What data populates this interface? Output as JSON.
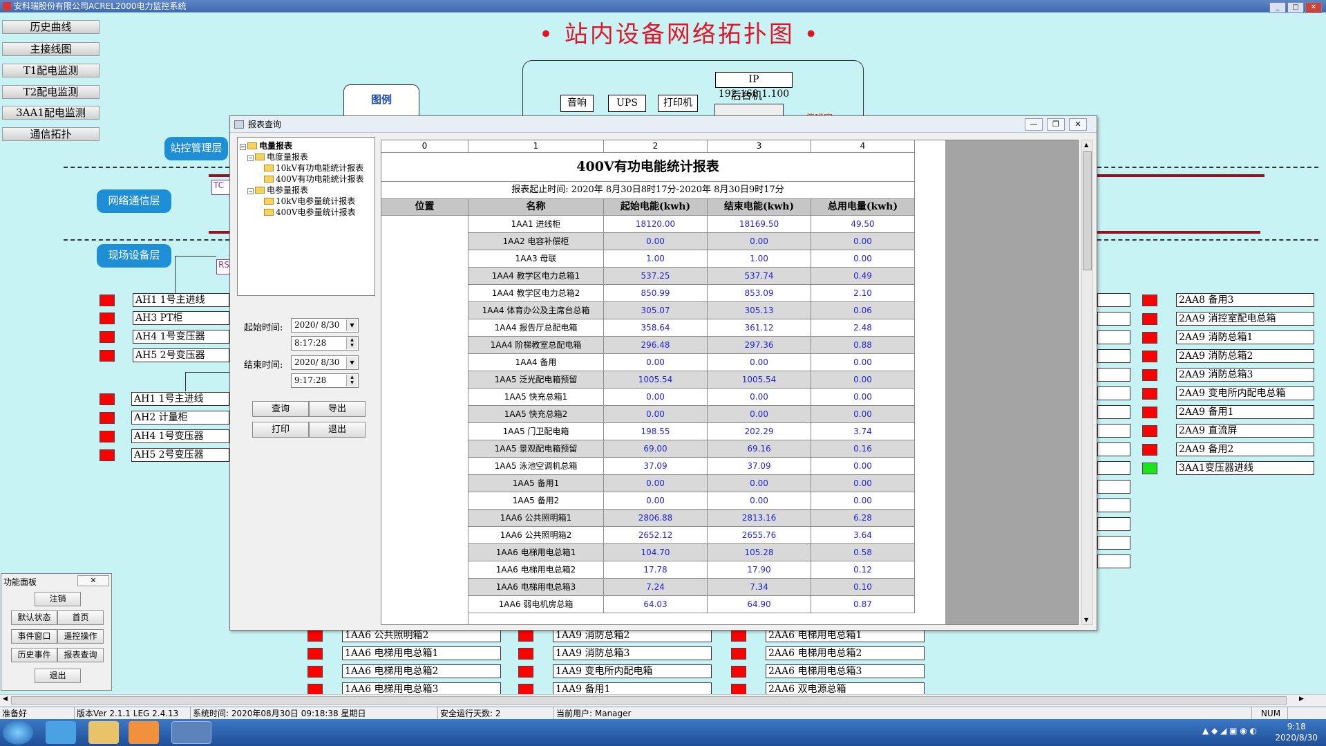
{
  "app": {
    "title": "安科瑞股份有限公司ACREL2000电力监控系统"
  },
  "nav": [
    "历史曲线",
    "主接线图",
    "T1配电监测",
    "T2配电监测",
    "3AA1配电监测",
    "通信拓扑"
  ],
  "main_title": "• 站内设备网络拓扑图 •",
  "layers": {
    "station": "站控管理层",
    "network": "网络通信层",
    "field": "现场设备层"
  },
  "topo": {
    "legend": "图例",
    "ip": "IP 192.168.1.100",
    "backend": "后台机",
    "speaker": "音响",
    "ups": "UPS",
    "printer": "打印机",
    "tcp_cut": "TC",
    "rs_cut": "RS",
    "comm_room_cut": "值班室"
  },
  "left_devices_1": [
    "AH1 1号主进线",
    "AH3 PT柜",
    "AH4 1号变压器",
    "AH5 2号变压器"
  ],
  "left_devices_2": [
    "AH1 1号主进线",
    "AH2 计量柜",
    "AH4 1号变压器",
    "AH5 2号变压器"
  ],
  "right_devices": [
    "2AA8 备用3",
    "2AA9 消控室配电总箱",
    "2AA9 消防总箱1",
    "2AA9 消防总箱2",
    "2AA9 消防总箱3",
    "2AA9 变电所内配电总箱",
    "2AA9 备用1",
    "2AA9 直流屏",
    "2AA9 备用2",
    "3AA1变压器进线"
  ],
  "right_device_colors": [
    "red",
    "red",
    "red",
    "red",
    "red",
    "red",
    "red",
    "red",
    "red",
    "green"
  ],
  "bottom_devices": [
    [
      "1AA6 公共照明箱2",
      "1AA6 电梯用电总箱1",
      "1AA6 电梯用电总箱2",
      "1AA6 电梯用电总箱3"
    ],
    [
      "1AA9 消防总箱2",
      "1AA9 消防总箱3",
      "1AA9 变电所内配电箱",
      "1AA9 备用1"
    ],
    [
      "2AA6 电梯用电总箱1",
      "2AA6 电梯用电总箱2",
      "2AA6 电梯用电总箱3",
      "2AA6 双电源总箱"
    ]
  ],
  "dialog": {
    "title": "报表查询",
    "tree": {
      "root": "电量报表",
      "group1": "电度量报表",
      "g1_items": [
        "10kV有功电能统计报表",
        "400V有功电能统计报表"
      ],
      "group2": "电参量报表",
      "g2_items": [
        "10kV电参量统计报表",
        "400V电参量统计报表"
      ]
    },
    "start_label": "起始时间:",
    "end_label": "结束时间:",
    "start_date": "2020/ 8/30",
    "start_time": "8:17:28",
    "end_date": "2020/ 8/30",
    "end_time": "9:17:28",
    "buttons": {
      "query": "查询",
      "export": "导出",
      "print": "打印",
      "exit": "退出"
    }
  },
  "report": {
    "col_index": [
      "0",
      "1",
      "2",
      "3",
      "4"
    ],
    "title": "400V有功电能统计报表",
    "period": "报表起止时间: 2020年 8月30日8时17分-2020年 8月30日9时17分",
    "headers": [
      "位置",
      "名称",
      "起始电能(kwh)",
      "结束电能(kwh)",
      "总用电量(kwh)"
    ],
    "rows": [
      [
        "1AA1 进线柜",
        "18120.00",
        "18169.50",
        "49.50"
      ],
      [
        "1AA2 电容补偿柜",
        "0.00",
        "0.00",
        "0.00"
      ],
      [
        "1AA3 母联",
        "1.00",
        "1.00",
        "0.00"
      ],
      [
        "1AA4 教学区电力总箱1",
        "537.25",
        "537.74",
        "0.49"
      ],
      [
        "1AA4 教学区电力总箱2",
        "850.99",
        "853.09",
        "2.10"
      ],
      [
        "1AA4 体育办公及主席台总箱",
        "305.07",
        "305.13",
        "0.06"
      ],
      [
        "1AA4 报告厅总配电箱",
        "358.64",
        "361.12",
        "2.48"
      ],
      [
        "1AA4 阶梯教室总配电箱",
        "296.48",
        "297.36",
        "0.88"
      ],
      [
        "1AA4 备用",
        "0.00",
        "0.00",
        "0.00"
      ],
      [
        "1AA5 泛光配电箱预留",
        "1005.54",
        "1005.54",
        "0.00"
      ],
      [
        "1AA5 快充总箱1",
        "0.00",
        "0.00",
        "0.00"
      ],
      [
        "1AA5 快充总箱2",
        "0.00",
        "0.00",
        "0.00"
      ],
      [
        "1AA5 门卫配电箱",
        "198.55",
        "202.29",
        "3.74"
      ],
      [
        "1AA5 景观配电箱预留",
        "69.00",
        "69.16",
        "0.16"
      ],
      [
        "1AA5 泳池空调机总箱",
        "37.09",
        "37.09",
        "0.00"
      ],
      [
        "1AA5 备用1",
        "0.00",
        "0.00",
        "0.00"
      ],
      [
        "1AA5 备用2",
        "0.00",
        "0.00",
        "0.00"
      ],
      [
        "1AA6 公共照明箱1",
        "2806.88",
        "2813.16",
        "6.28"
      ],
      [
        "1AA6 公共照明箱2",
        "2652.12",
        "2655.76",
        "3.64"
      ],
      [
        "1AA6 电梯用电总箱1",
        "104.70",
        "105.28",
        "0.58"
      ],
      [
        "1AA6 电梯用电总箱2",
        "17.78",
        "17.90",
        "0.12"
      ],
      [
        "1AA6 电梯用电总箱3",
        "7.24",
        "7.34",
        "0.10"
      ],
      [
        "1AA6 弱电机房总箱",
        "64.03",
        "64.90",
        "0.87"
      ]
    ]
  },
  "function_panel": {
    "title": "功能面板",
    "buttons": [
      "注销",
      "默认状态",
      "首页",
      "事件窗口",
      "遥控操作",
      "历史事件",
      "报表查询",
      "退出"
    ]
  },
  "status": {
    "ready": "准备好",
    "version": "版本Ver 2.1.1 LEG 2.4.13",
    "system_time": "系统时间: 2020年08月30日  09:18:38  星期日",
    "safe_days": "安全运行天数: 2",
    "user": "当前用户: Manager",
    "num": "NUM"
  },
  "clock": {
    "time": "9:18",
    "date": "2020/8/30"
  }
}
